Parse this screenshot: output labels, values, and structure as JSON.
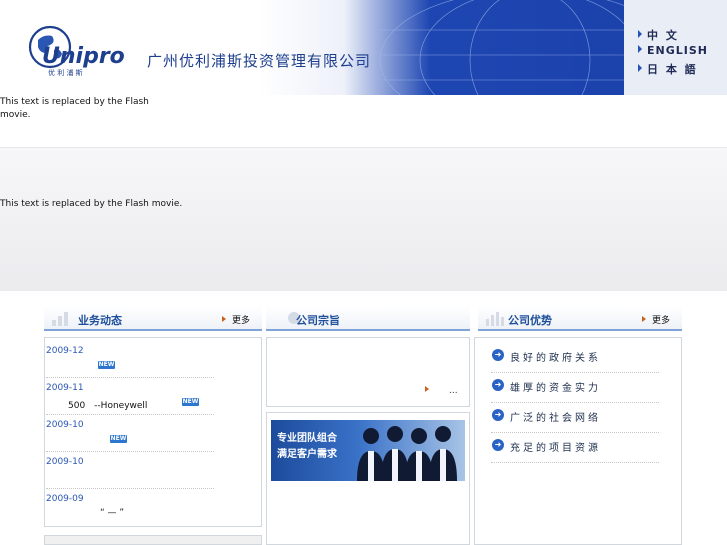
{
  "header": {
    "logo_text": "Unipro",
    "logo_sub": "优 利 浦 斯",
    "company_name": "广州优利浦斯投资管理有限公司",
    "languages": [
      "中 文",
      "ENGLISH",
      "日 本 語"
    ]
  },
  "flash": {
    "placeholder_1": "This text is replaced by the Flash movie.",
    "placeholder_2": "This text is replaced by the Flash movie."
  },
  "business_news": {
    "title": "业务动态",
    "more": "更多",
    "badge": "NEW",
    "items": [
      {
        "date": "2009-12",
        "text": "",
        "is_new": true
      },
      {
        "date": "2009-11",
        "text": "500　--Honeywell",
        "is_new": true
      },
      {
        "date": "2009-10",
        "text": "",
        "is_new": true
      },
      {
        "date": "2009-10",
        "text": "",
        "is_new": false
      },
      {
        "date": "2009-09",
        "text": "“ — ”",
        "is_new": false
      }
    ]
  },
  "company_purpose": {
    "title": "公司宗旨",
    "more": "...",
    "banner_line1": "专业团队组合",
    "banner_line2": "满足客户需求"
  },
  "company_advantages": {
    "title": "公司优势",
    "more": "更多",
    "items": [
      "良好的政府关系",
      "雄厚的资金实力",
      "广泛的社会网络",
      "充足的项目资源"
    ]
  },
  "colors": {
    "accent": "#1f4f9c",
    "banner_blue": "#1f49b6",
    "link": "#2a57b4"
  }
}
